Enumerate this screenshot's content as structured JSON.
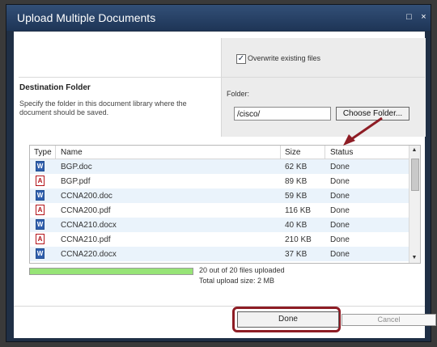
{
  "dialog": {
    "title": "Upload Multiple Documents",
    "controls": {
      "maximize": "□",
      "close": "×"
    }
  },
  "options": {
    "overwrite_label": "Overwrite existing files",
    "overwrite_checked": true
  },
  "destination": {
    "title": "Destination Folder",
    "description": "Specify the folder in this document library where the document should be saved.",
    "folder_label": "Folder:",
    "folder_value": "/cisco/",
    "choose_button": "Choose Folder..."
  },
  "files": {
    "headers": [
      "Type",
      "Name",
      "Size",
      "Status"
    ],
    "rows": [
      {
        "type_icon": "word-document-icon",
        "name": "BGP.doc",
        "size": "62 KB",
        "status": "Done"
      },
      {
        "type_icon": "pdf-document-icon",
        "name": "BGP.pdf",
        "size": "89 KB",
        "status": "Done"
      },
      {
        "type_icon": "word-document-icon",
        "name": "CCNA200.doc",
        "size": "59 KB",
        "status": "Done"
      },
      {
        "type_icon": "pdf-document-icon",
        "name": "CCNA200.pdf",
        "size": "116 KB",
        "status": "Done"
      },
      {
        "type_icon": "word-document-icon",
        "name": "CCNA210.docx",
        "size": "40 KB",
        "status": "Done"
      },
      {
        "type_icon": "pdf-document-icon",
        "name": "CCNA210.pdf",
        "size": "210 KB",
        "status": "Done"
      },
      {
        "type_icon": "word-document-icon",
        "name": "CCNA220.docx",
        "size": "37 KB",
        "status": "Done"
      }
    ]
  },
  "upload": {
    "progress_percent": 100,
    "summary": "20 out of 20 files uploaded",
    "total_size": "Total upload size: 2 MB"
  },
  "buttons": {
    "done": "Done",
    "cancel": "Cancel"
  },
  "colors": {
    "title_bar": "#2a4364",
    "progress": "#97e477",
    "highlight": "#8e1d25"
  },
  "icons": {
    "word": "W",
    "pdf": "A"
  }
}
